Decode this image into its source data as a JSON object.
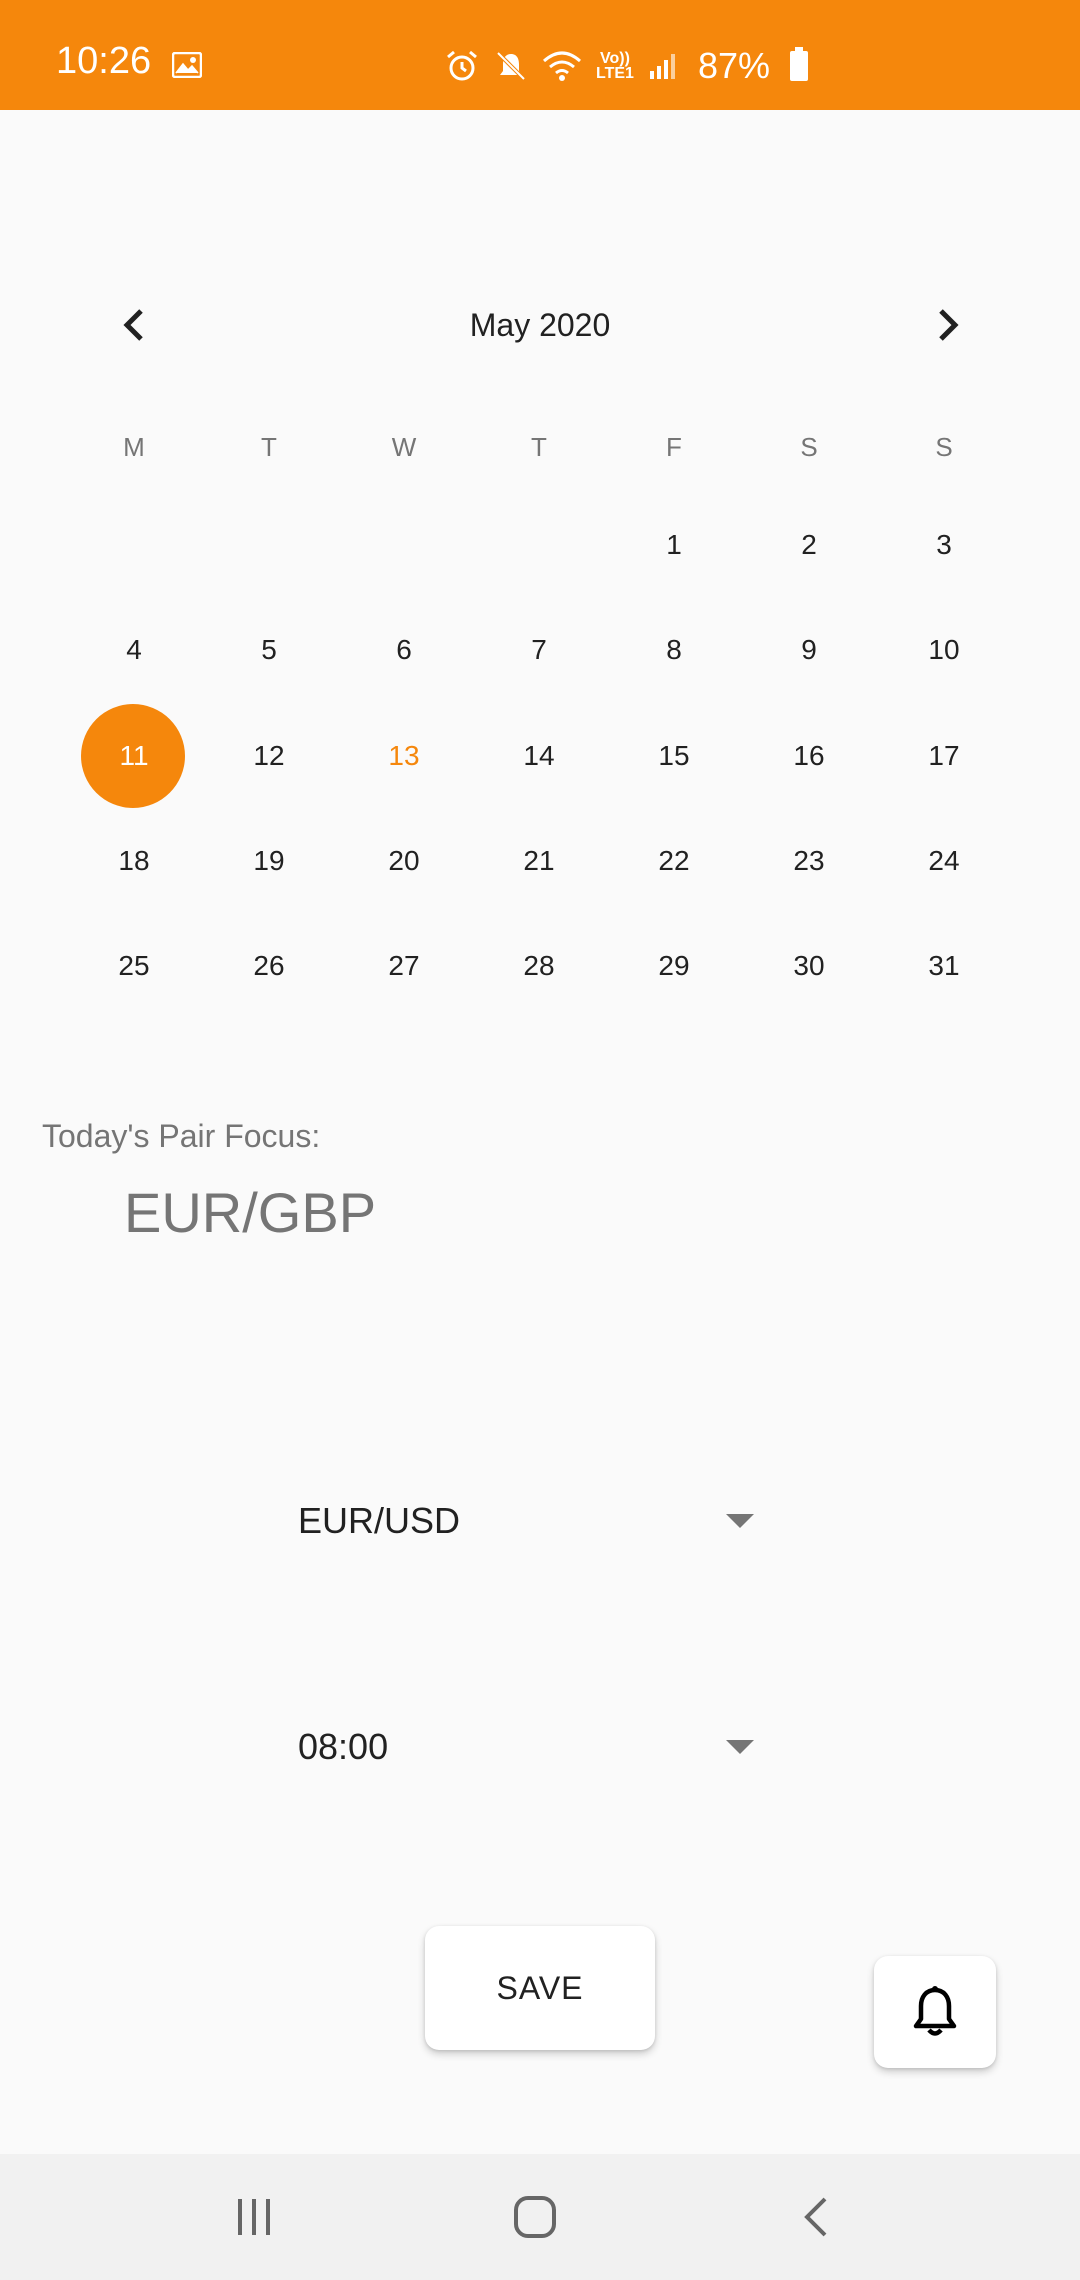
{
  "status_bar": {
    "time": "10:26",
    "battery": "87%",
    "lte_line1": "Vo))",
    "lte_line2": "LTE1",
    "color": "#f5870c"
  },
  "calendar": {
    "month_label": "May 2020",
    "weekdays": [
      "M",
      "T",
      "W",
      "T",
      "F",
      "S",
      "S"
    ],
    "weeks": [
      [
        "",
        "",
        "",
        "",
        "1",
        "2",
        "3"
      ],
      [
        "4",
        "5",
        "6",
        "7",
        "8",
        "9",
        "10"
      ],
      [
        "11",
        "12",
        "13",
        "14",
        "15",
        "16",
        "17"
      ],
      [
        "18",
        "19",
        "20",
        "21",
        "22",
        "23",
        "24"
      ],
      [
        "25",
        "26",
        "27",
        "28",
        "29",
        "30",
        "31"
      ]
    ],
    "selected_day": "11",
    "today": "13",
    "accent": "#f5870c"
  },
  "focus": {
    "label": "Today's Pair Focus:",
    "value": "EUR/GBP"
  },
  "pair_dropdown": {
    "selected": "EUR/USD"
  },
  "time_dropdown": {
    "selected": "08:00"
  },
  "save_button": {
    "label": "SAVE"
  }
}
